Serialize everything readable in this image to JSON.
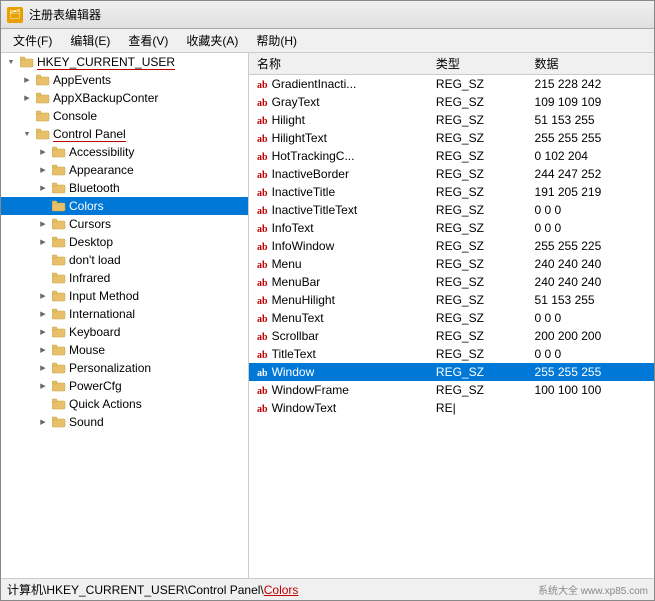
{
  "window": {
    "title": "注册表编辑器",
    "icon": "🗂"
  },
  "menu": {
    "items": [
      "文件(F)",
      "编辑(E)",
      "查看(V)",
      "收藏夹(A)",
      "帮助(H)"
    ]
  },
  "tree": {
    "items": [
      {
        "id": "hkcu",
        "label": "HKEY_CURRENT_USER",
        "indent": 0,
        "expanded": true,
        "expand": "expanded"
      },
      {
        "id": "appevents",
        "label": "AppEvents",
        "indent": 1,
        "expanded": false,
        "expand": "collapsed"
      },
      {
        "id": "appxbackup",
        "label": "AppXBackupConter",
        "indent": 1,
        "expanded": false,
        "expand": "collapsed"
      },
      {
        "id": "console",
        "label": "Console",
        "indent": 1,
        "expanded": false,
        "expand": "leaf"
      },
      {
        "id": "controlpanel",
        "label": "Control Panel",
        "indent": 1,
        "expanded": true,
        "expand": "expanded"
      },
      {
        "id": "accessibility",
        "label": "Accessibility",
        "indent": 2,
        "expanded": false,
        "expand": "collapsed"
      },
      {
        "id": "appearance",
        "label": "Appearance",
        "indent": 2,
        "expanded": false,
        "expand": "collapsed"
      },
      {
        "id": "bluetooth",
        "label": "Bluetooth",
        "indent": 2,
        "expanded": false,
        "expand": "collapsed"
      },
      {
        "id": "colors",
        "label": "Colors",
        "indent": 2,
        "expanded": false,
        "expand": "leaf",
        "selected": true
      },
      {
        "id": "cursors",
        "label": "Cursors",
        "indent": 2,
        "expanded": false,
        "expand": "collapsed"
      },
      {
        "id": "desktop",
        "label": "Desktop",
        "indent": 2,
        "expanded": false,
        "expand": "collapsed"
      },
      {
        "id": "dontload",
        "label": "don't load",
        "indent": 2,
        "expanded": false,
        "expand": "leaf"
      },
      {
        "id": "infrared",
        "label": "Infrared",
        "indent": 2,
        "expanded": false,
        "expand": "leaf"
      },
      {
        "id": "inputmethod",
        "label": "Input Method",
        "indent": 2,
        "expanded": false,
        "expand": "collapsed"
      },
      {
        "id": "international",
        "label": "International",
        "indent": 2,
        "expanded": false,
        "expand": "collapsed"
      },
      {
        "id": "keyboard",
        "label": "Keyboard",
        "indent": 2,
        "expanded": false,
        "expand": "collapsed"
      },
      {
        "id": "mouse",
        "label": "Mouse",
        "indent": 2,
        "expanded": false,
        "expand": "collapsed"
      },
      {
        "id": "personalization",
        "label": "Personalization",
        "indent": 2,
        "expanded": false,
        "expand": "collapsed"
      },
      {
        "id": "powercfg",
        "label": "PowerCfg",
        "indent": 2,
        "expanded": false,
        "expand": "collapsed"
      },
      {
        "id": "quickactions",
        "label": "Quick Actions",
        "indent": 2,
        "expanded": false,
        "expand": "leaf"
      },
      {
        "id": "sound",
        "label": "Sound",
        "indent": 2,
        "expanded": false,
        "expand": "collapsed"
      }
    ]
  },
  "detail": {
    "columns": [
      "名称",
      "类型",
      "数据"
    ],
    "rows": [
      {
        "name": "GradientInacti...",
        "type": "REG_SZ",
        "value": "215 228 242"
      },
      {
        "name": "GrayText",
        "type": "REG_SZ",
        "value": "109 109 109"
      },
      {
        "name": "Hilight",
        "type": "REG_SZ",
        "value": "51 153 255"
      },
      {
        "name": "HilightText",
        "type": "REG_SZ",
        "value": "255 255 255"
      },
      {
        "name": "HotTrackingC...",
        "type": "REG_SZ",
        "value": "0 102 204"
      },
      {
        "name": "InactiveBorder",
        "type": "REG_SZ",
        "value": "244 247 252"
      },
      {
        "name": "InactiveTitle",
        "type": "REG_SZ",
        "value": "191 205 219"
      },
      {
        "name": "InactiveTitleText",
        "type": "REG_SZ",
        "value": "0 0 0"
      },
      {
        "name": "InfoText",
        "type": "REG_SZ",
        "value": "0 0 0"
      },
      {
        "name": "InfoWindow",
        "type": "REG_SZ",
        "value": "255 255 225"
      },
      {
        "name": "Menu",
        "type": "REG_SZ",
        "value": "240 240 240"
      },
      {
        "name": "MenuBar",
        "type": "REG_SZ",
        "value": "240 240 240"
      },
      {
        "name": "MenuHilight",
        "type": "REG_SZ",
        "value": "51 153 255"
      },
      {
        "name": "MenuText",
        "type": "REG_SZ",
        "value": "0 0 0"
      },
      {
        "name": "Scrollbar",
        "type": "REG_SZ",
        "value": "200 200 200"
      },
      {
        "name": "TitleText",
        "type": "REG_SZ",
        "value": "0 0 0"
      },
      {
        "name": "Window",
        "type": "REG_SZ",
        "value": "255 255 255",
        "selected": true
      },
      {
        "name": "WindowFrame",
        "type": "REG_SZ",
        "value": "100 100 100"
      },
      {
        "name": "WindowText",
        "type": "RE|",
        "value": ""
      }
    ]
  },
  "status": {
    "text": "计算机\\HKEY_CURRENT_USER\\Control Panel\\Colors"
  },
  "watermark": {
    "site": "www.xp85.com"
  }
}
